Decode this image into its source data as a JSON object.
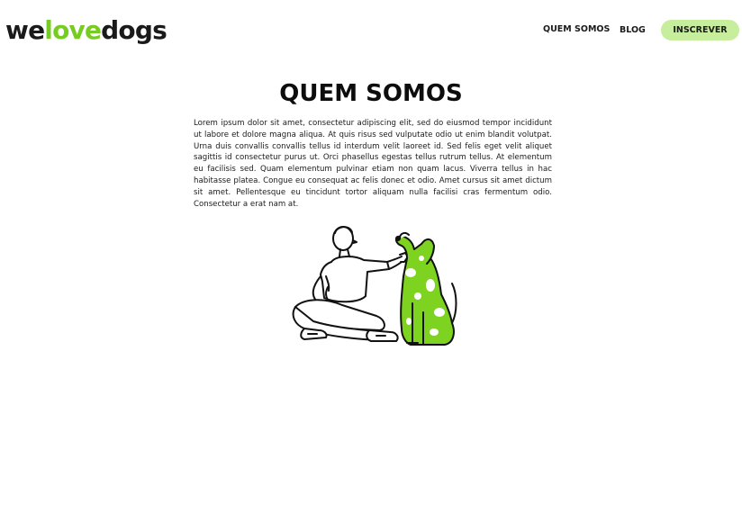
{
  "header": {
    "logo": {
      "part1": "we",
      "part2": "love",
      "part3": "dogs"
    },
    "nav": {
      "quem_somos": "QUEM SOMOS",
      "blog": "BLOG"
    },
    "subscribe_label": "INSCREVER"
  },
  "main": {
    "title": "QUEM SOMOS",
    "body": "Lorem ipsum dolor sit amet, consectetur adipiscing elit, sed do eiusmod tempor incididunt ut labore et dolore magna aliqua. At quis risus sed vulputate odio ut enim blandit volutpat. Urna duis convallis convallis tellus id interdum velit laoreet id. Sed felis eget velit aliquet sagittis id consectetur purus ut. Orci phasellus egestas tellus rutrum tellus. At elementum eu facilisis sed.  Quam elementum pulvinar etiam non quam lacus. Viverra tellus in hac habitasse platea. Congue eu consequat ac felis donec et odio. Amet cursus sit amet dictum sit amet. Pellentesque eu tincidunt tortor aliquam nulla facilisi cras fermentum odio. Consectetur a erat nam at."
  },
  "colors": {
    "accent": "#77cc22",
    "button_bg": "#c6ee9c",
    "text": "#1a1a1a",
    "background": "#ffffff"
  },
  "illustration": {
    "icon": "man-with-dog-illustration"
  }
}
